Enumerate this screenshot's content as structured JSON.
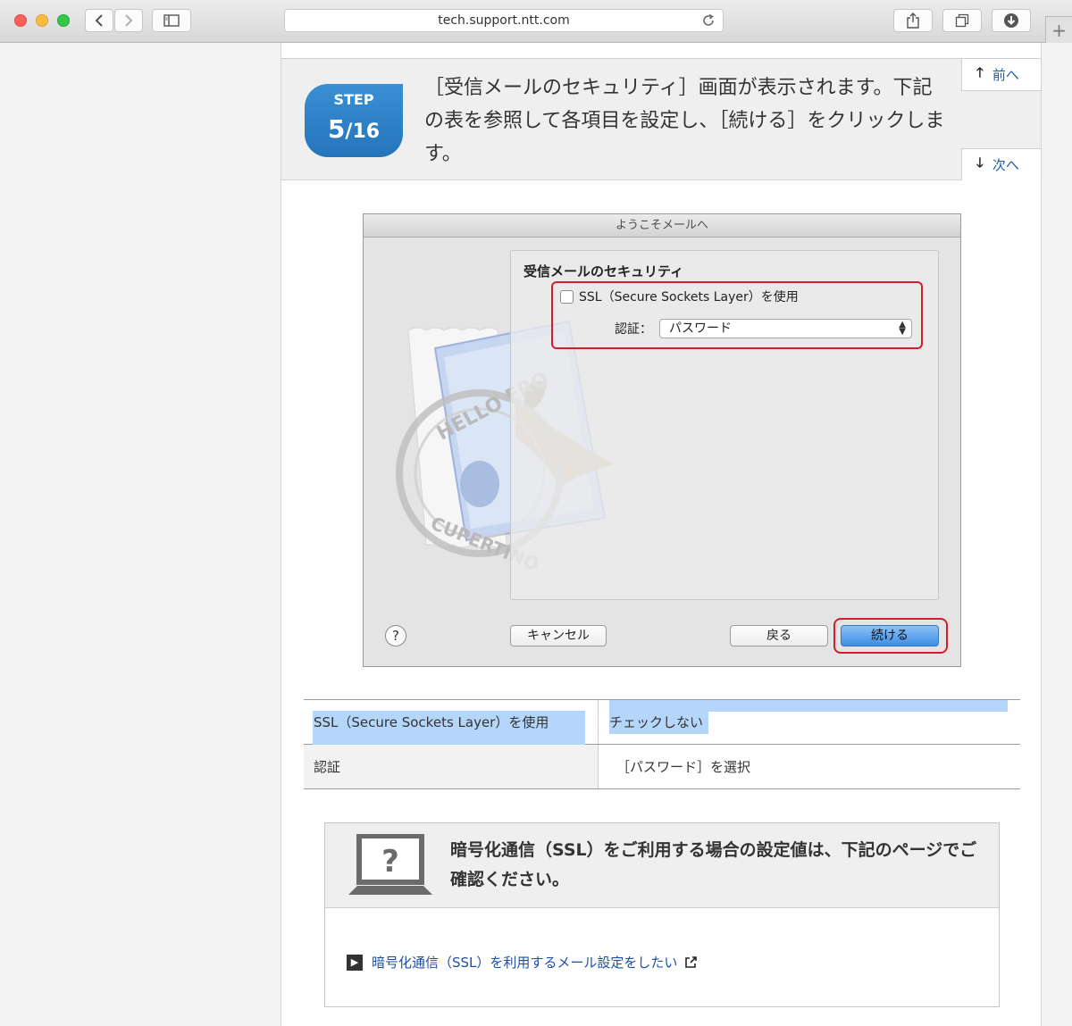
{
  "browser": {
    "url": "tech.support.ntt.com"
  },
  "step": {
    "badge_label": "STEP",
    "current": "5",
    "total": "/16",
    "text": "［受信メールのセキュリティ］画面が表示されます。下記の表を参照して各項目を設定し、［続ける］をクリックします。",
    "prev_label": "前へ",
    "next_label": "次へ"
  },
  "mail_dialog": {
    "window_title": "ようこそメールへ",
    "panel_title": "受信メールのセキュリティ",
    "ssl_checkbox_label": "SSL（Secure Sockets Layer）を使用",
    "ssl_checked": false,
    "auth_label": "認証：",
    "auth_value": "パスワード",
    "help_label": "?",
    "cancel_label": "キャンセル",
    "back_label": "戻る",
    "continue_label": "続ける",
    "stamp_text_top": "HELLO FRO",
    "stamp_text_bottom": "CUPERTINO",
    "accent_red": "#d21d2c",
    "accent_blue": "#3d8ee8"
  },
  "settings": [
    {
      "key": "SSL（Secure Sockets Layer）を使用",
      "value": "チェックしない"
    },
    {
      "key": "認証",
      "value": "［パスワード］を選択"
    }
  ],
  "notice": {
    "icon": "question-laptop-icon",
    "text": "暗号化通信（SSL）をご利用する場合の設定値は、下記のページでご確認ください。",
    "link_label": "暗号化通信（SSL）を利用するメール設定をしたい",
    "link_color": "#1e4fa5"
  }
}
